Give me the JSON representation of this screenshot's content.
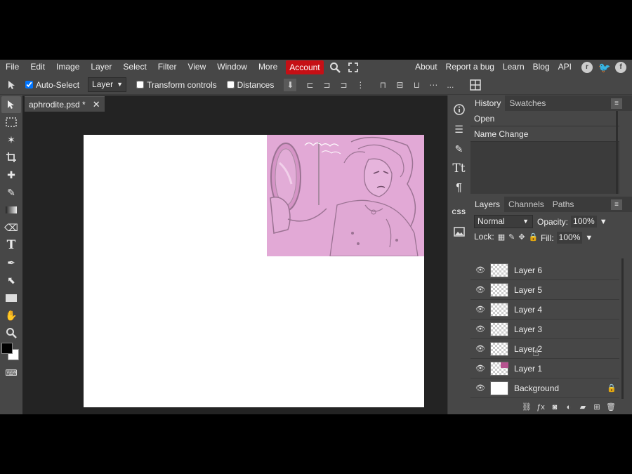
{
  "menubar": {
    "items": [
      "File",
      "Edit",
      "Image",
      "Layer",
      "Select",
      "Filter",
      "View",
      "Window",
      "More"
    ],
    "account": "Account",
    "right_items": [
      "About",
      "Report a bug",
      "Learn",
      "Blog",
      "API"
    ]
  },
  "options": {
    "auto_select_label": "Auto-Select",
    "auto_select_checked": true,
    "target_select": "Layer",
    "transform_label": "Transform controls",
    "distances_label": "Distances",
    "more": "..."
  },
  "document": {
    "tab_title": "aphrodite.psd *",
    "close": "✕"
  },
  "history": {
    "tabs": [
      "History",
      "Swatches"
    ],
    "items": [
      "Open",
      "Name Change"
    ]
  },
  "layers": {
    "tabs": [
      "Layers",
      "Channels",
      "Paths"
    ],
    "blend_mode": "Normal",
    "opacity_label": "Opacity:",
    "opacity_value": "100%",
    "lock_label": "Lock:",
    "fill_label": "Fill:",
    "fill_value": "100%",
    "items": [
      {
        "name": "Layer 6"
      },
      {
        "name": "Layer 5"
      },
      {
        "name": "Layer 4"
      },
      {
        "name": "Layer 3"
      },
      {
        "name": "Layer 2"
      },
      {
        "name": "Layer 1"
      },
      {
        "name": "Background"
      }
    ]
  },
  "midbar": {
    "css_label": "CSS"
  },
  "colors": {
    "accent": "#c60f15",
    "foreground": "#000000",
    "background": "#ffffff",
    "artwork_tint": "#e3a9d4"
  }
}
